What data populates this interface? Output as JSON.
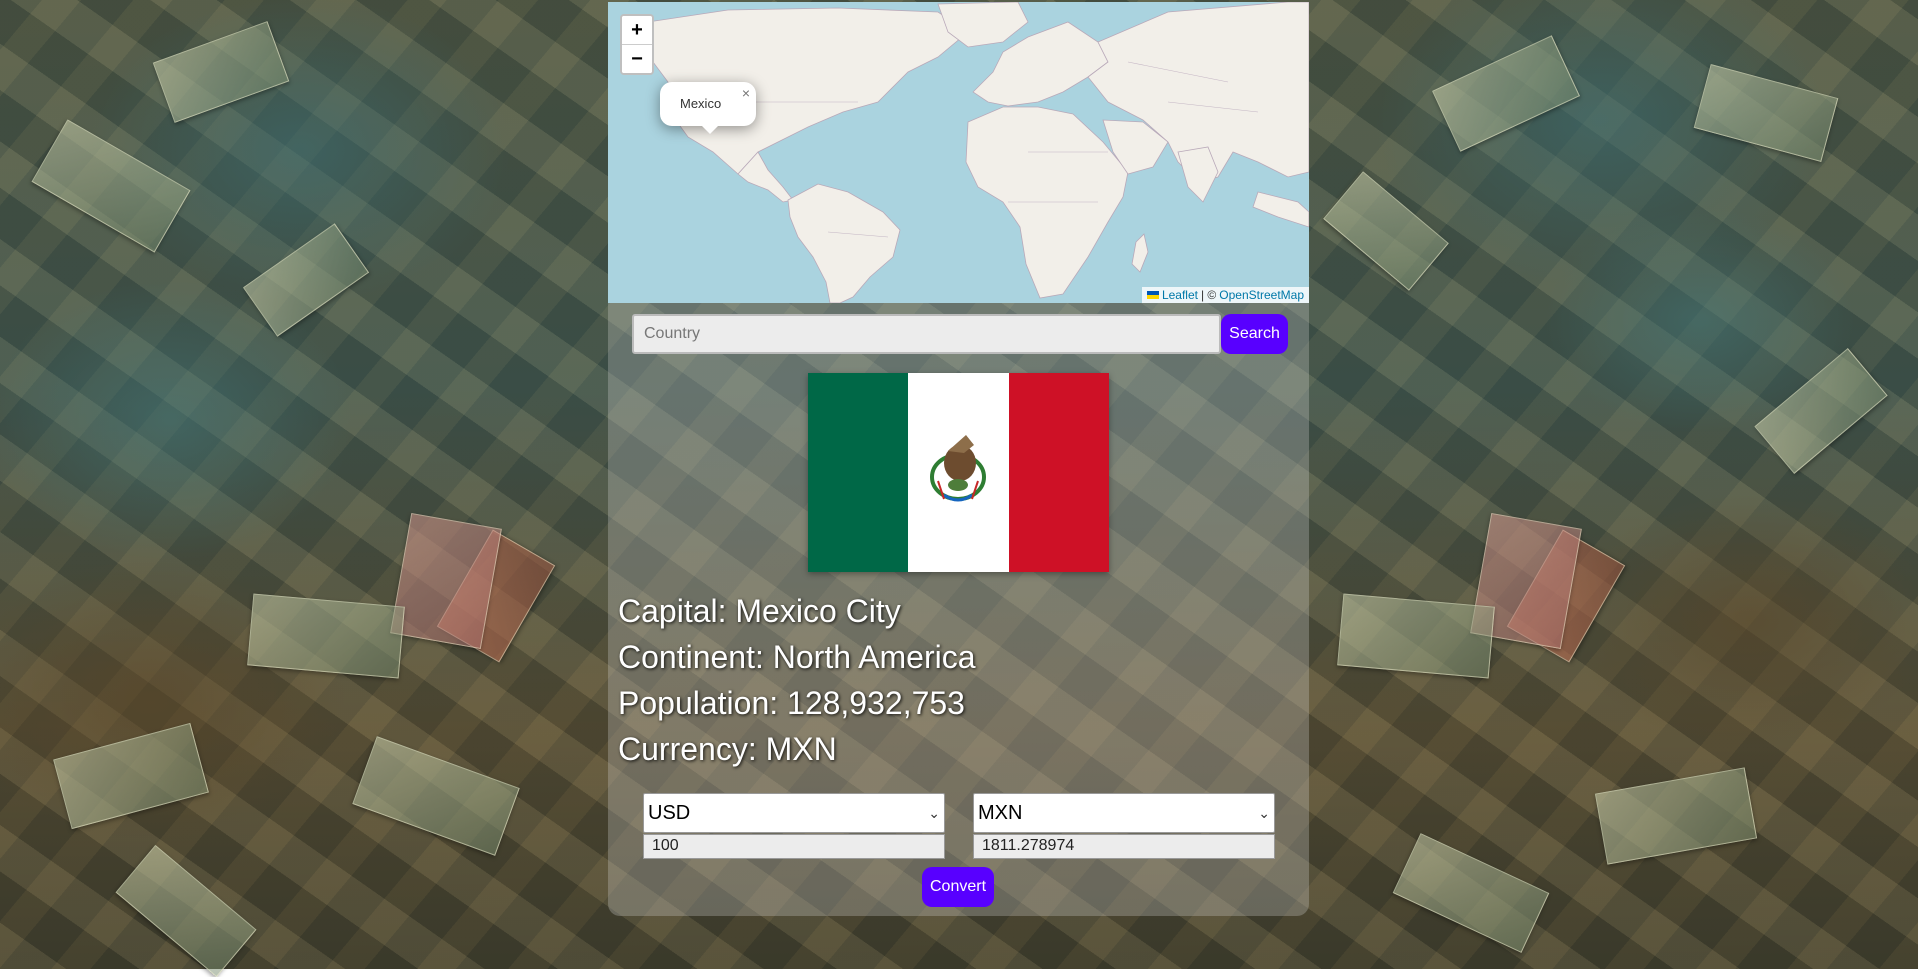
{
  "map": {
    "zoom_in_label": "+",
    "zoom_out_label": "−",
    "popup": {
      "label": "Mexico",
      "close_label": "×"
    },
    "attribution": {
      "leaflet": "Leaflet",
      "separator": "| ©",
      "osm": "OpenStreetMap"
    }
  },
  "search": {
    "placeholder": "Country",
    "value": "",
    "button_label": "Search"
  },
  "country": {
    "flag": {
      "name": "Mexico",
      "colors": [
        "#006847",
        "#ffffff",
        "#ce1126"
      ]
    },
    "capital": "Capital: Mexico City",
    "continent": "Continent: North America",
    "population": "Population: 128,932,753",
    "currency": "Currency: MXN"
  },
  "converter": {
    "from_currency": "USD",
    "to_currency": "MXN",
    "from_amount": "100",
    "to_amount": "1811.278974",
    "button_label": "Convert"
  },
  "colors": {
    "accent": "#5800ff",
    "ocean": "#aad3df",
    "land": "#f2efe9"
  }
}
